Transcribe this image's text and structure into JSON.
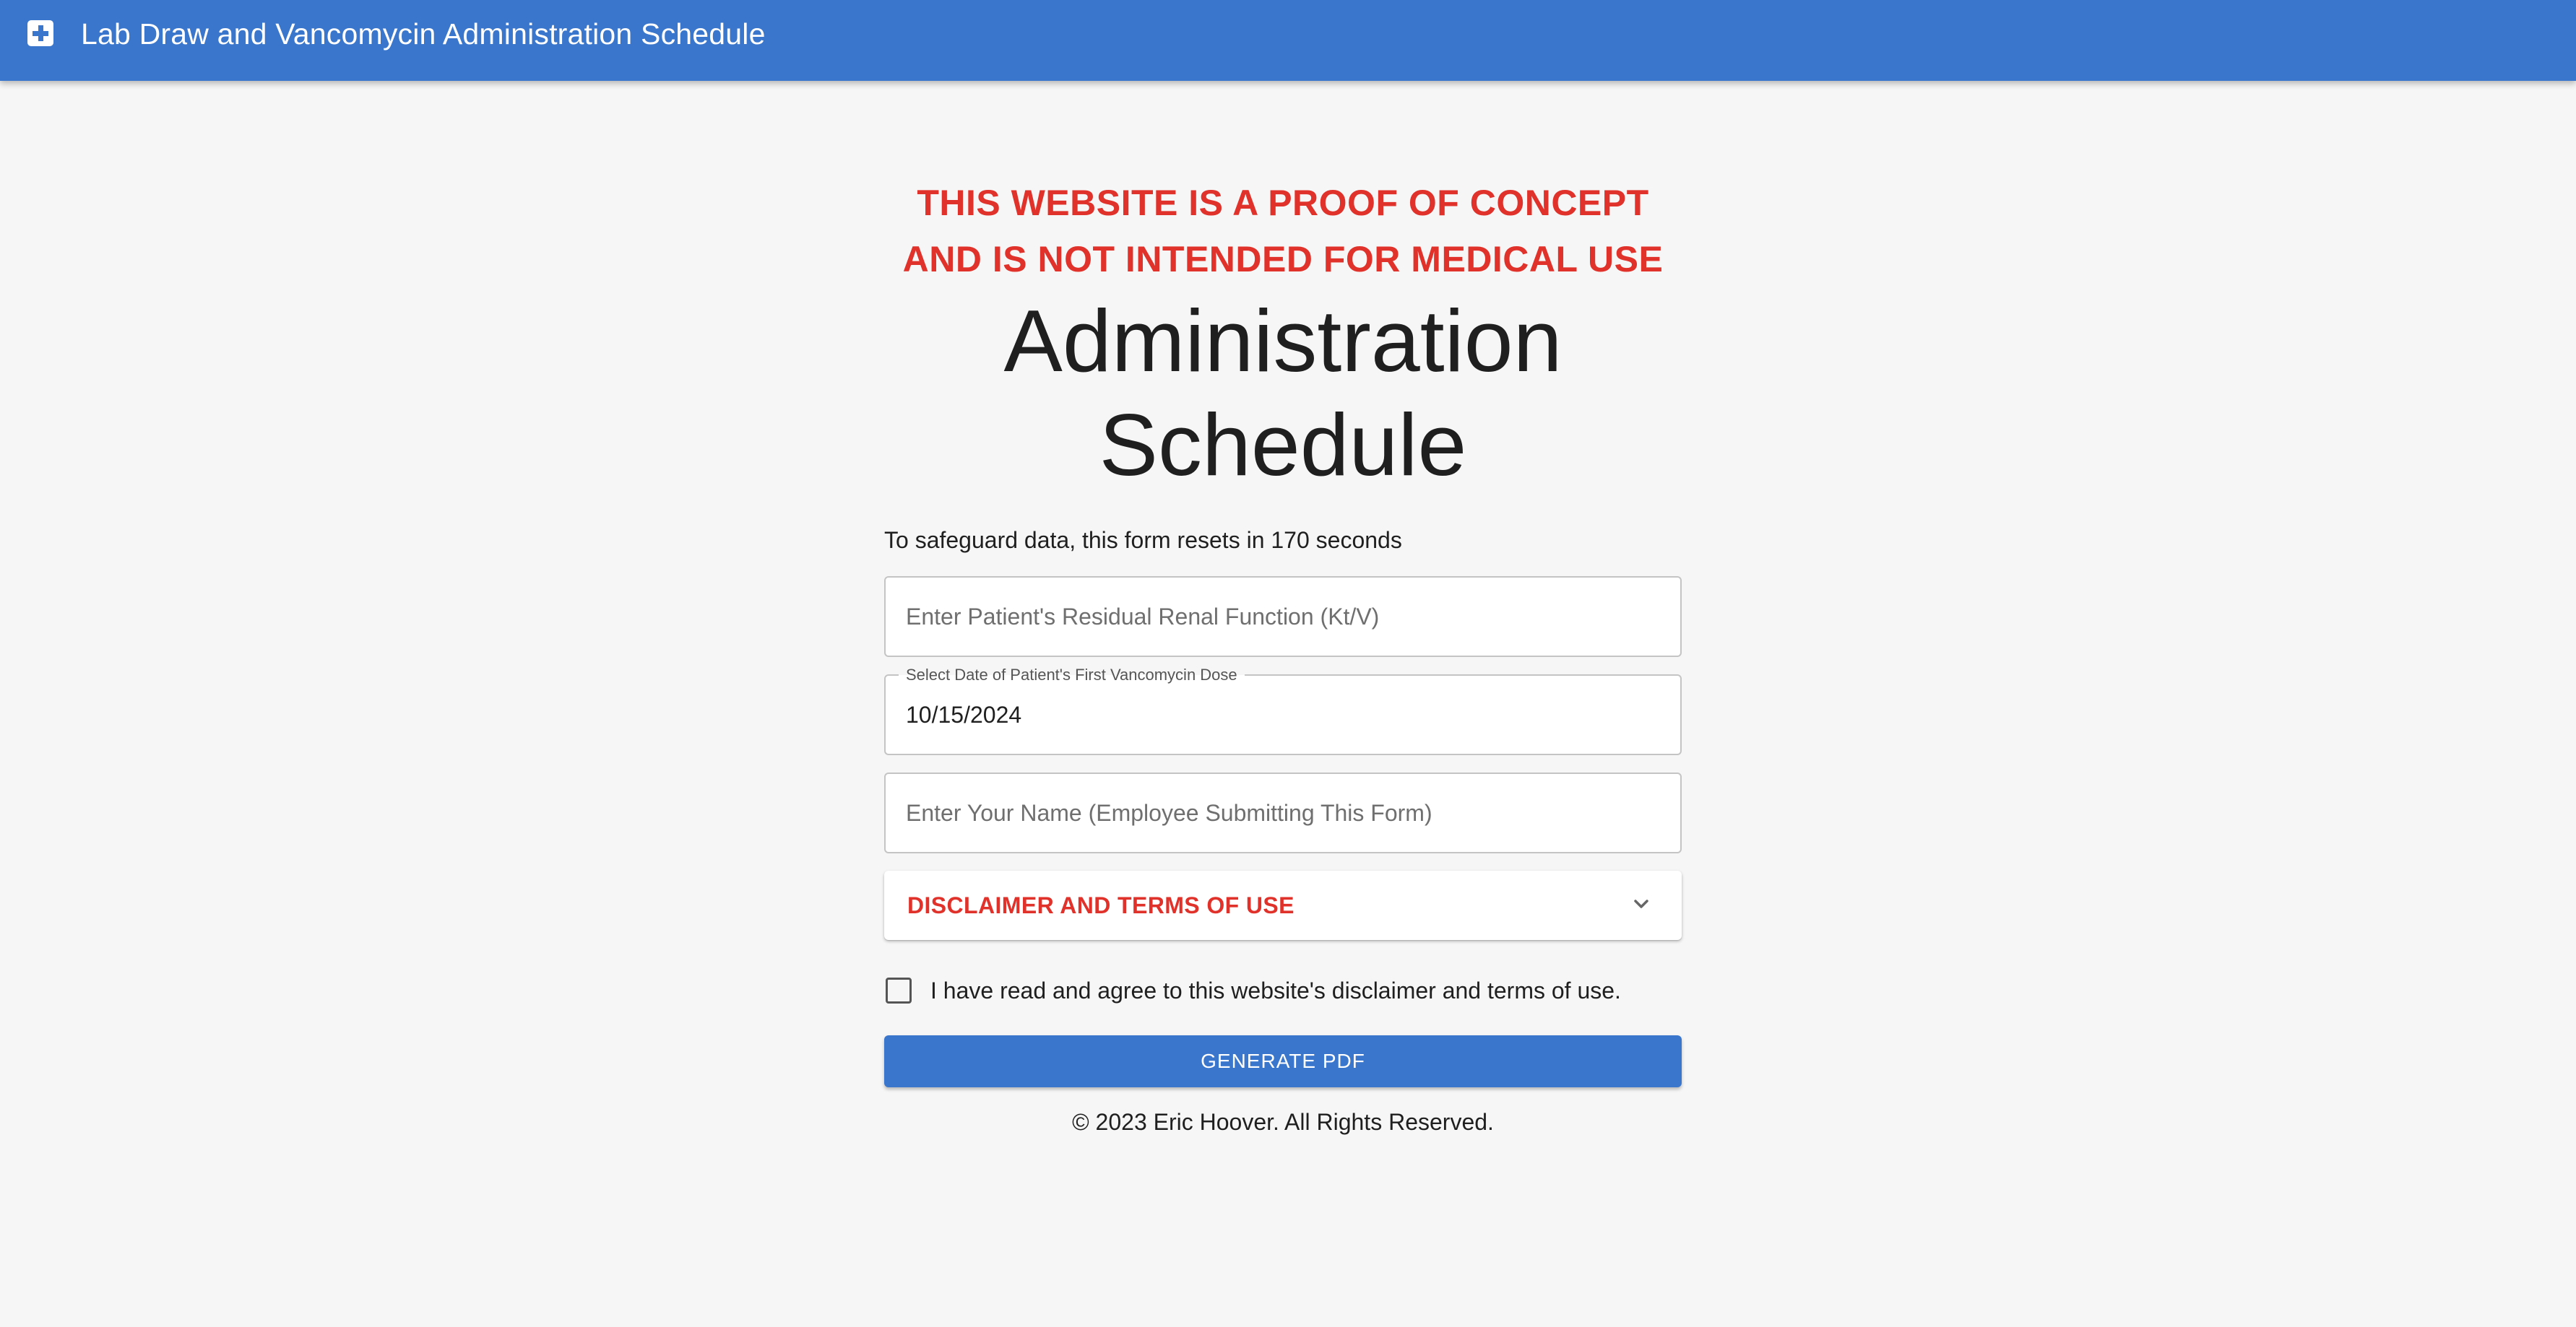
{
  "appbar": {
    "icon": "medical-cross-icon",
    "title": "Lab Draw and Vancomycin Administration Schedule"
  },
  "warning": {
    "line1": "THIS WEBSITE IS A PROOF OF CONCEPT",
    "line2": "AND IS NOT INTENDED FOR MEDICAL USE"
  },
  "page": {
    "title_line1": "Administration",
    "title_line2": "Schedule"
  },
  "form": {
    "reset_note": "To safeguard data, this form resets in 170 seconds",
    "renal_field": {
      "placeholder": "Enter Patient's Residual Renal Function (Kt/V)",
      "value": ""
    },
    "date_field": {
      "label": "Select Date of Patient's First Vancomycin Dose",
      "value": "10/15/2024"
    },
    "name_field": {
      "placeholder": "Enter Your Name (Employee Submitting This Form)",
      "value": ""
    },
    "disclaimer": {
      "label": "DISCLAIMER AND TERMS OF USE",
      "icon": "chevron-down-icon",
      "expanded": false
    },
    "agree": {
      "label": "I have read and agree to this website's disclaimer and terms of use.",
      "checked": false
    },
    "generate_button": "GENERATE PDF"
  },
  "footer": {
    "copyright": "© 2023 Eric Hoover. All Rights Reserved."
  },
  "colors": {
    "primary": "#3a76cc",
    "warning": "#e0322a",
    "background": "#f6f6f6"
  }
}
